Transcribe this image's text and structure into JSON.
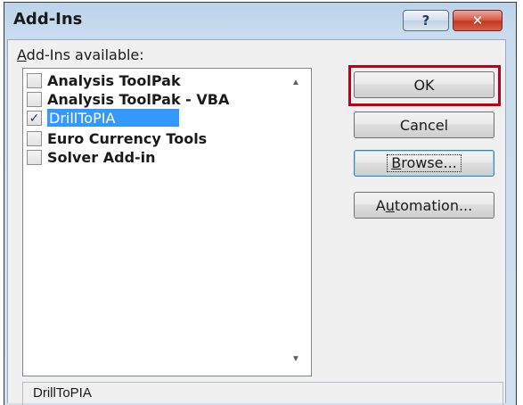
{
  "window": {
    "title": "Add-Ins",
    "help_glyph": "?",
    "close_glyph": "✕"
  },
  "list": {
    "label_prefix": "A",
    "label_rest": "dd-Ins available:",
    "items": [
      {
        "label": "Analysis ToolPak",
        "checked": false,
        "selected": false
      },
      {
        "label": "Analysis ToolPak - VBA",
        "checked": false,
        "selected": false
      },
      {
        "label": "DrillToPIA",
        "checked": true,
        "selected": true
      },
      {
        "label": "Euro Currency Tools",
        "checked": false,
        "selected": false
      },
      {
        "label": "Solver Add-in",
        "checked": false,
        "selected": false
      }
    ],
    "check_glyph": "✓",
    "scroll_up_icon": "▲",
    "scroll_down_icon": "▼"
  },
  "description": {
    "text": "DrillToPIA"
  },
  "buttons": {
    "ok": "OK",
    "cancel": "Cancel",
    "browse_prefix": "B",
    "browse_rest": "rowse...",
    "automation_prefix": "A",
    "automation_mid": "u",
    "automation_rest": "tomation..."
  },
  "colors": {
    "selection": "#3399ff",
    "ok_highlight": "#c00019",
    "close_button": "#c2381f"
  }
}
